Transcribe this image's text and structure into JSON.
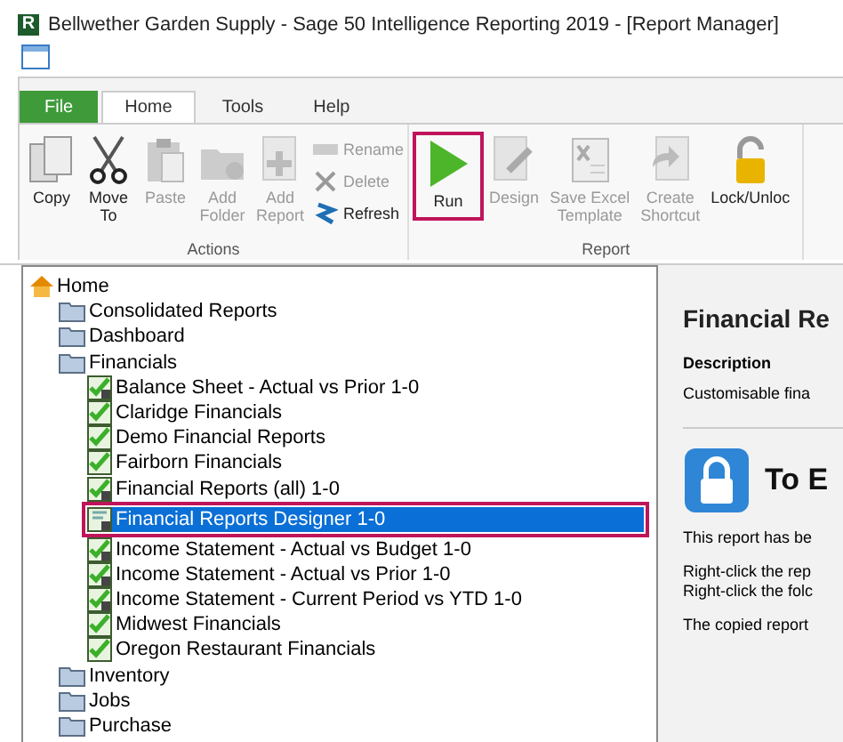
{
  "window": {
    "logo": "R",
    "title": "Bellwether Garden Supply - Sage 50 Intelligence Reporting 2019 - [Report Manager]"
  },
  "ribbon": {
    "tabs": [
      {
        "label": "File",
        "kind": "file",
        "selected": false
      },
      {
        "label": "Home",
        "kind": "tab",
        "selected": true
      },
      {
        "label": "Tools",
        "kind": "tab",
        "selected": false
      },
      {
        "label": "Help",
        "kind": "tab",
        "selected": false
      }
    ],
    "groups": [
      {
        "label": "Actions",
        "buttons": [
          {
            "label": "Copy",
            "kind": "large",
            "disabled": false,
            "highlighted": false
          },
          {
            "label": "Move\nTo",
            "kind": "large",
            "disabled": false,
            "highlighted": false
          },
          {
            "label": "Paste",
            "kind": "large",
            "disabled": true,
            "highlighted": false
          },
          {
            "label": "Add\nFolder",
            "kind": "large",
            "disabled": true,
            "highlighted": false
          },
          {
            "label": "Add\nReport",
            "kind": "large",
            "disabled": true,
            "highlighted": false
          },
          {
            "label": "Rename",
            "kind": "small",
            "disabled": true,
            "highlighted": false
          },
          {
            "label": "Delete",
            "kind": "small",
            "disabled": true,
            "highlighted": false
          },
          {
            "label": "Refresh",
            "kind": "small",
            "disabled": false,
            "highlighted": false
          }
        ]
      },
      {
        "label": "Report",
        "buttons": [
          {
            "label": "Run",
            "kind": "large",
            "disabled": false,
            "highlighted": true
          },
          {
            "label": "Design",
            "kind": "large",
            "disabled": true,
            "highlighted": false
          },
          {
            "label": "Save Excel\nTemplate",
            "kind": "large",
            "disabled": true,
            "highlighted": false
          },
          {
            "label": "Create\nShortcut",
            "kind": "large",
            "disabled": true,
            "highlighted": false
          },
          {
            "label": "Lock/Unloc",
            "kind": "large",
            "disabled": false,
            "highlighted": false
          }
        ]
      }
    ]
  },
  "tree": [
    {
      "label": "Home",
      "kind": "home",
      "selected": false,
      "highlighted": false,
      "children": [
        {
          "label": "Consolidated Reports",
          "kind": "folder",
          "selected": false,
          "highlighted": false
        },
        {
          "label": "Dashboard",
          "kind": "folder",
          "selected": false,
          "highlighted": false
        },
        {
          "label": "Financials",
          "kind": "folder",
          "selected": false,
          "highlighted": false,
          "children": [
            {
              "label": "Balance Sheet - Actual vs Prior 1-0",
              "kind": "locked_report",
              "selected": false,
              "highlighted": false
            },
            {
              "label": "Claridge Financials",
              "kind": "report",
              "selected": false,
              "highlighted": false
            },
            {
              "label": "Demo Financial Reports",
              "kind": "report",
              "selected": false,
              "highlighted": false
            },
            {
              "label": "Fairborn Financials",
              "kind": "report",
              "selected": false,
              "highlighted": false
            },
            {
              "label": "Financial Reports (all) 1-0",
              "kind": "locked_report",
              "selected": false,
              "highlighted": false
            },
            {
              "label": "Financial Reports Designer 1-0",
              "kind": "designer",
              "selected": true,
              "highlighted": true
            },
            {
              "label": "Income Statement - Actual vs Budget 1-0",
              "kind": "locked_report",
              "selected": false,
              "highlighted": false
            },
            {
              "label": "Income Statement - Actual vs Prior 1-0",
              "kind": "locked_report",
              "selected": false,
              "highlighted": false
            },
            {
              "label": "Income Statement - Current Period vs YTD 1-0",
              "kind": "locked_report",
              "selected": false,
              "highlighted": false
            },
            {
              "label": "Midwest Financials",
              "kind": "report",
              "selected": false,
              "highlighted": false
            },
            {
              "label": "Oregon Restaurant Financials",
              "kind": "report",
              "selected": false,
              "highlighted": false
            }
          ]
        },
        {
          "label": "Inventory",
          "kind": "folder",
          "selected": false,
          "highlighted": false
        },
        {
          "label": "Jobs",
          "kind": "folder",
          "selected": false,
          "highlighted": false
        },
        {
          "label": "Purchase",
          "kind": "folder",
          "selected": false,
          "highlighted": false
        }
      ]
    }
  ],
  "details": {
    "title": "Financial Re",
    "description_heading": "Description",
    "description": "Customisable fina",
    "notice_title": "To E",
    "paragraphs": [
      "This report has be",
      "Right-click the rep\nRight-click the folc",
      "The copied report"
    ]
  }
}
